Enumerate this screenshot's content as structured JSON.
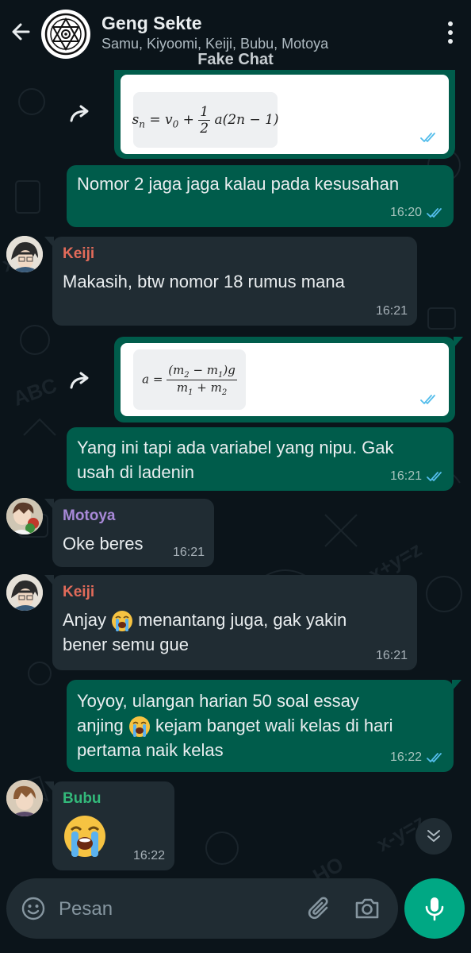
{
  "header": {
    "title": "Geng Sekte",
    "members": "Samu, Kiyoomi, Keiji, Bubu, Motoya",
    "watermark": "Fake Chat"
  },
  "messages": [
    {
      "id": "m1",
      "direction": "out",
      "type": "image",
      "formula": "s_n = v_0 + 1/2 a(2n − 1)",
      "time": ""
    },
    {
      "id": "m2",
      "direction": "out",
      "type": "text",
      "text": "Nomor 2 jaga jaga kalau pada kesusahan",
      "time": "16:20",
      "status": "read"
    },
    {
      "id": "m3",
      "direction": "in",
      "sender": "Keiji",
      "sender_color": "#e26b5a",
      "text": "Makasih, btw nomor 18 rumus mana",
      "time": "16:21"
    },
    {
      "id": "m4",
      "direction": "out",
      "type": "image",
      "formula": "a = (m2 − m1)g / (m1 + m2)",
      "time": ""
    },
    {
      "id": "m5",
      "direction": "out",
      "type": "text",
      "text_line1": "Yang ini tapi ada variabel yang nipu. Gak",
      "text_line2": "usah di ladenin",
      "time": "16:21",
      "status": "read"
    },
    {
      "id": "m6",
      "direction": "in",
      "sender": "Motoya",
      "sender_color": "#a889d8",
      "text": "Oke beres",
      "time": "16:21"
    },
    {
      "id": "m7",
      "direction": "in",
      "sender": "Keiji",
      "sender_color": "#e26b5a",
      "text_a": "Anjay",
      "text_b": "menantang juga, gak yakin",
      "text_line2": "bener semu gue",
      "time": "16:21"
    },
    {
      "id": "m8",
      "direction": "out",
      "type": "text",
      "text_line1": "Yoyoy, ulangan harian 50 soal essay",
      "text_a": "anjing",
      "text_b": "kejam banget wali kelas di hari",
      "text_line3": "pertama naik kelas",
      "time": "16:22",
      "status": "read"
    },
    {
      "id": "m9",
      "direction": "in",
      "sender": "Bubu",
      "sender_color": "#33b97a",
      "text": "",
      "emoji": "loudly-crying-face",
      "time": "16:22"
    }
  ],
  "composer": {
    "placeholder": "Pesan"
  },
  "colors": {
    "background": "#0b141a",
    "outgoing_bubble": "#005c4b",
    "incoming_bubble": "#202c33",
    "accent": "#00a884",
    "read_ticks": "#53bdeb"
  }
}
